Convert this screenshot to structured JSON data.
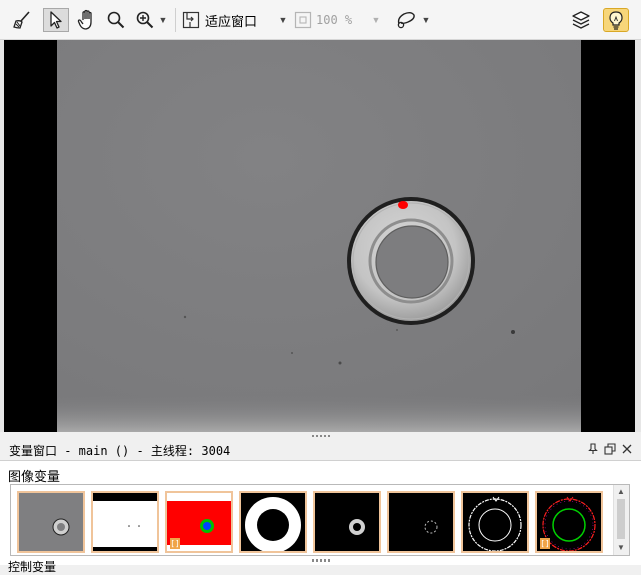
{
  "toolbar": {
    "tools": [
      "brush-icon",
      "pointer-icon",
      "hand-pan-icon",
      "zoom-icon",
      "zoom-in-icon"
    ],
    "fit_label": "适应窗口",
    "zoom_value": "100 %",
    "zoom_state": "disabled",
    "active_tool": "pointer-icon",
    "right_tools": [
      "lasso-icon",
      "layers-icon",
      "bulb-icon"
    ]
  },
  "variable_window": {
    "title": "变量窗口 - main () - 主线程: 3004",
    "section_label": "图像变量",
    "thumbnails": [
      {
        "name": "original-gray"
      },
      {
        "name": "binary-white",
        "badge": ""
      },
      {
        "name": "red-region",
        "badge": "[]"
      },
      {
        "name": "ring-white"
      },
      {
        "name": "ring-small-dark"
      },
      {
        "name": "edge-dots"
      },
      {
        "name": "contours-white"
      },
      {
        "name": "contours-color",
        "badge": "[]"
      }
    ],
    "bottom_text": "控制变量"
  },
  "colors": {
    "toolbar_bg": "#f5f5f5",
    "image_bg": "#7e7e80",
    "highlight": "#f7d67a",
    "thumb_border": "#f0c49a",
    "defect_red": "#ff0000"
  }
}
